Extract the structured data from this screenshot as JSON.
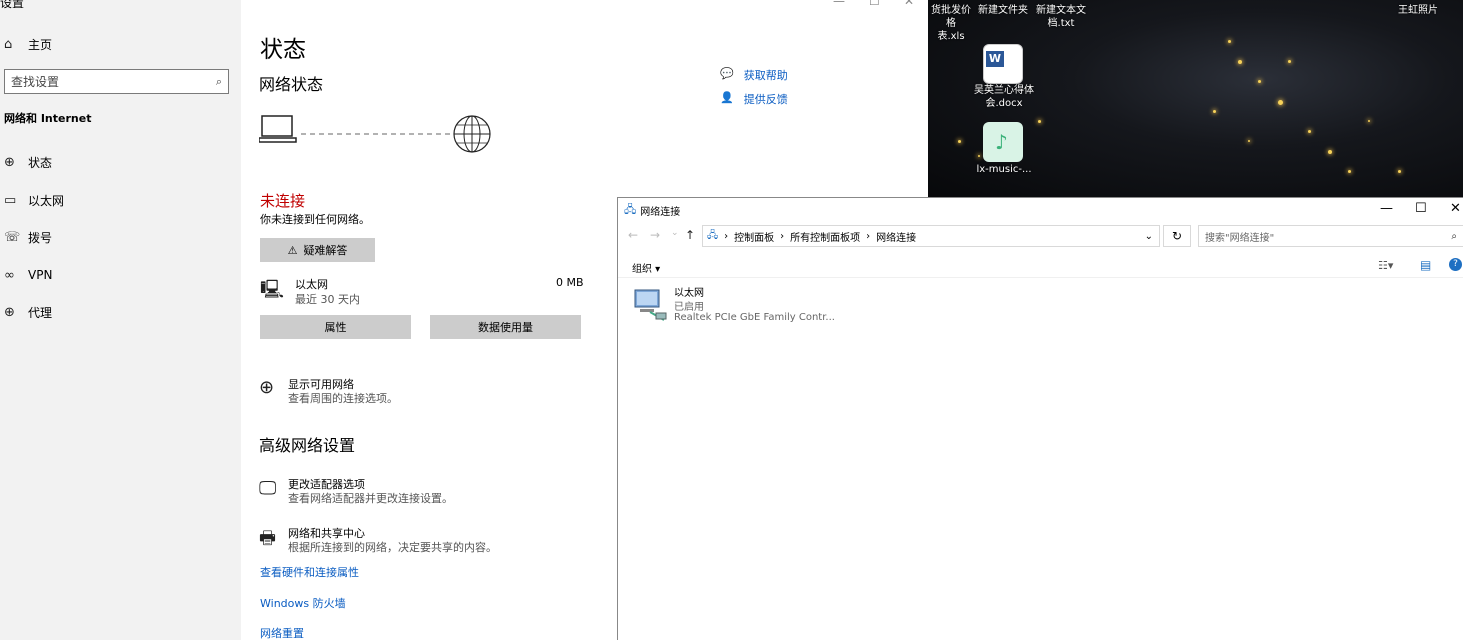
{
  "settings": {
    "caption": "设置",
    "sidebar": {
      "home": "主页",
      "search_placeholder": "查找设置",
      "section": "网络和 Internet",
      "items": [
        {
          "label": "状态",
          "icon": "status-icon"
        },
        {
          "label": "以太网",
          "icon": "ethernet-icon"
        },
        {
          "label": "拨号",
          "icon": "dialup-icon"
        },
        {
          "label": "VPN",
          "icon": "vpn-icon"
        },
        {
          "label": "代理",
          "icon": "proxy-icon"
        }
      ]
    },
    "main": {
      "title": "状态",
      "network_status": "网络状态",
      "help": "获取帮助",
      "feedback": "提供反馈",
      "status": "未连接",
      "status_desc": "你未连接到任何网络。",
      "troubleshoot": "疑难解答",
      "ethernet_name": "以太网",
      "ethernet_sub": "最近 30 天内",
      "ethernet_usage": "0 MB",
      "properties_btn": "属性",
      "data_usage_btn": "数据使用量",
      "show_networks": "显示可用网络",
      "show_networks_sub": "查看周围的连接选项。",
      "advanced": "高级网络设置",
      "adapter": "更改适配器选项",
      "adapter_sub": "查看网络适配器并更改连接设置。",
      "sharing": "网络和共享中心",
      "sharing_sub": "根据所连接到的网络，决定要共享的内容。",
      "link_hw": "查看硬件和连接属性",
      "link_fw": "Windows 防火墙",
      "link_reset": "网络重置"
    }
  },
  "desktop": {
    "icons": [
      {
        "label1": "货批发价格",
        "label2": "表.xls"
      },
      {
        "label1": "新建文件夹",
        "label2": ""
      },
      {
        "label1": "新建文本文",
        "label2": "档.txt"
      },
      {
        "label1": "王虹照片",
        "label2": ""
      },
      {
        "label1": "吴英兰心得体",
        "label2": "会.docx"
      },
      {
        "label1": "lx-music-...",
        "label2": ""
      }
    ]
  },
  "explorer": {
    "title": "网络连接",
    "breadcrumb": [
      "控制面板",
      "所有控制面板项",
      "网络连接"
    ],
    "search_placeholder": "搜索\"网络连接\"",
    "organize": "组织 ▾",
    "item": {
      "name": "以太网",
      "status": "已启用",
      "device": "Realtek PCIe GbE Family Contr..."
    }
  }
}
